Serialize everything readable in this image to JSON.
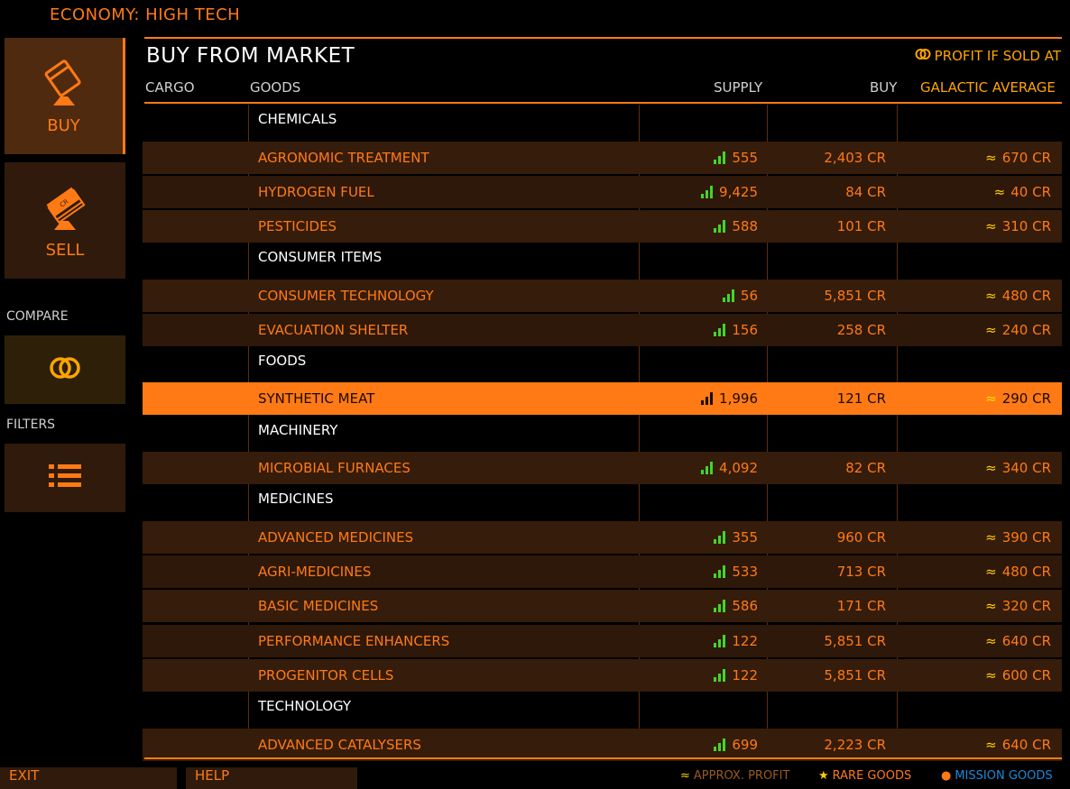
{
  "header": {
    "economy": "ECONOMY: HIGH TECH",
    "title": "BUY FROM MARKET",
    "profit_hint": "PROFIT IF SOLD AT"
  },
  "sidebar": {
    "buy_label": "BUY",
    "sell_label": "SELL",
    "compare_label": "COMPARE",
    "filters_label": "FILTERS"
  },
  "columns": {
    "cargo": "CARGO",
    "goods": "GOODS",
    "supply": "SUPPLY",
    "buy": "BUY",
    "galactic_average": "GALACTIC AVERAGE"
  },
  "table": {
    "categories": [
      {
        "label": "CHEMICALS"
      },
      {
        "label": "CONSUMER ITEMS"
      },
      {
        "label": "FOODS"
      },
      {
        "label": "MACHINERY"
      },
      {
        "label": "MEDICINES"
      },
      {
        "label": "TECHNOLOGY"
      }
    ],
    "items": [
      {
        "name": "AGRONOMIC TREATMENT",
        "supply": "555",
        "buy": "2,403 CR",
        "avg": "670 CR"
      },
      {
        "name": "HYDROGEN FUEL",
        "supply": "9,425",
        "buy": "84 CR",
        "avg": "40 CR"
      },
      {
        "name": "PESTICIDES",
        "supply": "588",
        "buy": "101 CR",
        "avg": "310 CR"
      },
      {
        "name": "CONSUMER TECHNOLOGY",
        "supply": "56",
        "buy": "5,851 CR",
        "avg": "480 CR"
      },
      {
        "name": "EVACUATION SHELTER",
        "supply": "156",
        "buy": "258 CR",
        "avg": "240 CR"
      },
      {
        "name": "SYNTHETIC MEAT",
        "supply": "1,996",
        "buy": "121 CR",
        "avg": "290 CR"
      },
      {
        "name": "MICROBIAL FURNACES",
        "supply": "4,092",
        "buy": "82 CR",
        "avg": "340 CR"
      },
      {
        "name": "ADVANCED MEDICINES",
        "supply": "355",
        "buy": "960 CR",
        "avg": "390 CR"
      },
      {
        "name": "AGRI-MEDICINES",
        "supply": "533",
        "buy": "713 CR",
        "avg": "480 CR"
      },
      {
        "name": "BASIC MEDICINES",
        "supply": "586",
        "buy": "171 CR",
        "avg": "320 CR"
      },
      {
        "name": "PERFORMANCE ENHANCERS",
        "supply": "122",
        "buy": "5,851 CR",
        "avg": "640 CR"
      },
      {
        "name": "PROGENITOR CELLS",
        "supply": "122",
        "buy": "5,851 CR",
        "avg": "600 CR"
      },
      {
        "name": "ADVANCED CATALYSERS",
        "supply": "699",
        "buy": "2,223 CR",
        "avg": "640 CR"
      }
    ],
    "approx_symbol": "≈"
  },
  "footer": {
    "exit_label": "EXIT",
    "help_label": "HELP",
    "legend_approx": "APPROX. PROFIT",
    "legend_rare": "RARE GOODS",
    "legend_mission": "MISSION GOODS"
  },
  "colors": {
    "accent": "#ff7a14",
    "selected_row": "#ff7a14",
    "supply_bars": "#3fd82a",
    "approx": "#ffd000",
    "mission": "#1e88d8"
  },
  "icons": {
    "buy": "cargo-box-icon",
    "sell": "credit-stack-icon",
    "compare": "compare-rings-icon",
    "filters": "filter-list-icon",
    "supply": "signal-bars-icon"
  }
}
